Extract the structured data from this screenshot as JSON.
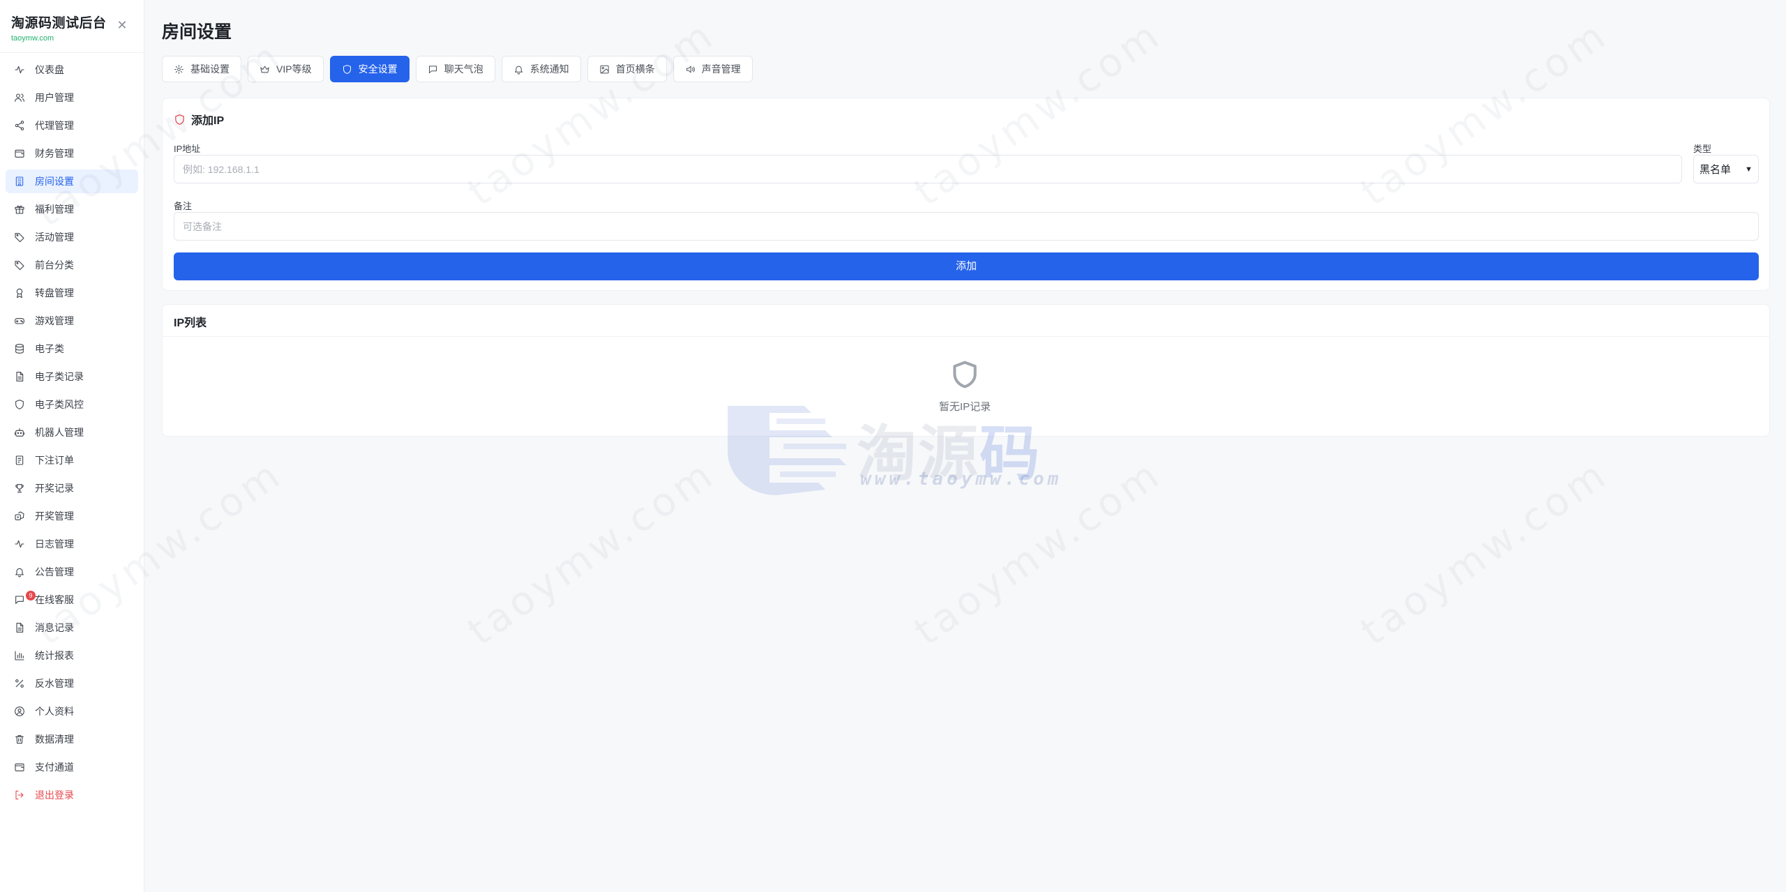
{
  "brand": {
    "title": "淘源码测试后台",
    "subtitle": "taoymw.com"
  },
  "sidebar": {
    "items": [
      {
        "label": "仪表盘",
        "icon": "activity-icon"
      },
      {
        "label": "用户管理",
        "icon": "users-icon"
      },
      {
        "label": "代理管理",
        "icon": "share-icon"
      },
      {
        "label": "财务管理",
        "icon": "wallet-icon"
      },
      {
        "label": "房间设置",
        "icon": "building-icon",
        "active": true
      },
      {
        "label": "福利管理",
        "icon": "gift-icon"
      },
      {
        "label": "活动管理",
        "icon": "tag-icon"
      },
      {
        "label": "前台分类",
        "icon": "tag-icon"
      },
      {
        "label": "转盘管理",
        "icon": "award-icon"
      },
      {
        "label": "游戏管理",
        "icon": "gamepad-icon"
      },
      {
        "label": "电子类",
        "icon": "database-icon"
      },
      {
        "label": "电子类记录",
        "icon": "file-icon"
      },
      {
        "label": "电子类风控",
        "icon": "shield-icon"
      },
      {
        "label": "机器人管理",
        "icon": "bot-icon"
      },
      {
        "label": "下注订单",
        "icon": "receipt-icon"
      },
      {
        "label": "开奖记录",
        "icon": "trophy-icon"
      },
      {
        "label": "开奖管理",
        "icon": "dice-icon"
      },
      {
        "label": "日志管理",
        "icon": "activity-icon"
      },
      {
        "label": "公告管理",
        "icon": "bell-icon"
      },
      {
        "label": "在线客服",
        "icon": "message-icon",
        "badge": "9"
      },
      {
        "label": "消息记录",
        "icon": "file-icon"
      },
      {
        "label": "统计报表",
        "icon": "bar-chart-icon"
      },
      {
        "label": "反水管理",
        "icon": "percent-icon"
      },
      {
        "label": "个人资料",
        "icon": "user-circle-icon"
      },
      {
        "label": "数据清理",
        "icon": "trash-icon"
      },
      {
        "label": "支付通道",
        "icon": "wallet-icon"
      },
      {
        "label": "退出登录",
        "icon": "logout-icon",
        "danger": true
      }
    ]
  },
  "page": {
    "title": "房间设置"
  },
  "tabs": [
    {
      "label": "基础设置",
      "icon": "gear-icon"
    },
    {
      "label": "VIP等级",
      "icon": "crown-icon"
    },
    {
      "label": "安全设置",
      "icon": "shield-icon",
      "active": true
    },
    {
      "label": "聊天气泡",
      "icon": "message-icon"
    },
    {
      "label": "系统通知",
      "icon": "bell-icon"
    },
    {
      "label": "首页横条",
      "icon": "image-icon"
    },
    {
      "label": "声音管理",
      "icon": "volume-icon"
    }
  ],
  "add_ip": {
    "title": "添加IP",
    "ip_label": "IP地址",
    "ip_placeholder": "例如: 192.168.1.1",
    "type_label": "类型",
    "type_value": "黑名单",
    "note_label": "备注",
    "note_placeholder": "可选备注",
    "submit_label": "添加"
  },
  "ip_list": {
    "title": "IP列表",
    "empty_text": "暂无IP记录"
  },
  "watermark": {
    "text": "taoymw.com",
    "logo_text": "淘源码",
    "logo_url": "www.taoymw.com"
  },
  "colors": {
    "primary": "#2563eb",
    "danger": "#e5484d",
    "brand_sub": "#20b26b"
  }
}
